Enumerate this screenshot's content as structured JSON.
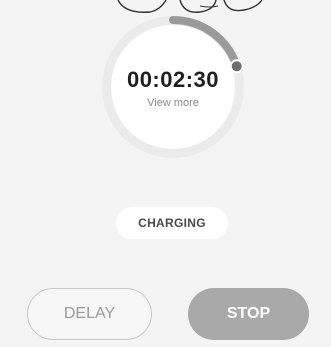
{
  "timer": {
    "elapsed": "00:02:30",
    "view_more_label": "View more",
    "progress_fraction": 0.2
  },
  "status": {
    "label": "CHARGING"
  },
  "actions": {
    "delay_label": "DELAY",
    "stop_label": "STOP"
  },
  "colors": {
    "background": "#f4f4f4",
    "ring_track": "#eeeeee",
    "ring_progress": "#9a9a9a",
    "stop_button": "#a9a9a9",
    "delay_border": "#c9c9c9"
  }
}
